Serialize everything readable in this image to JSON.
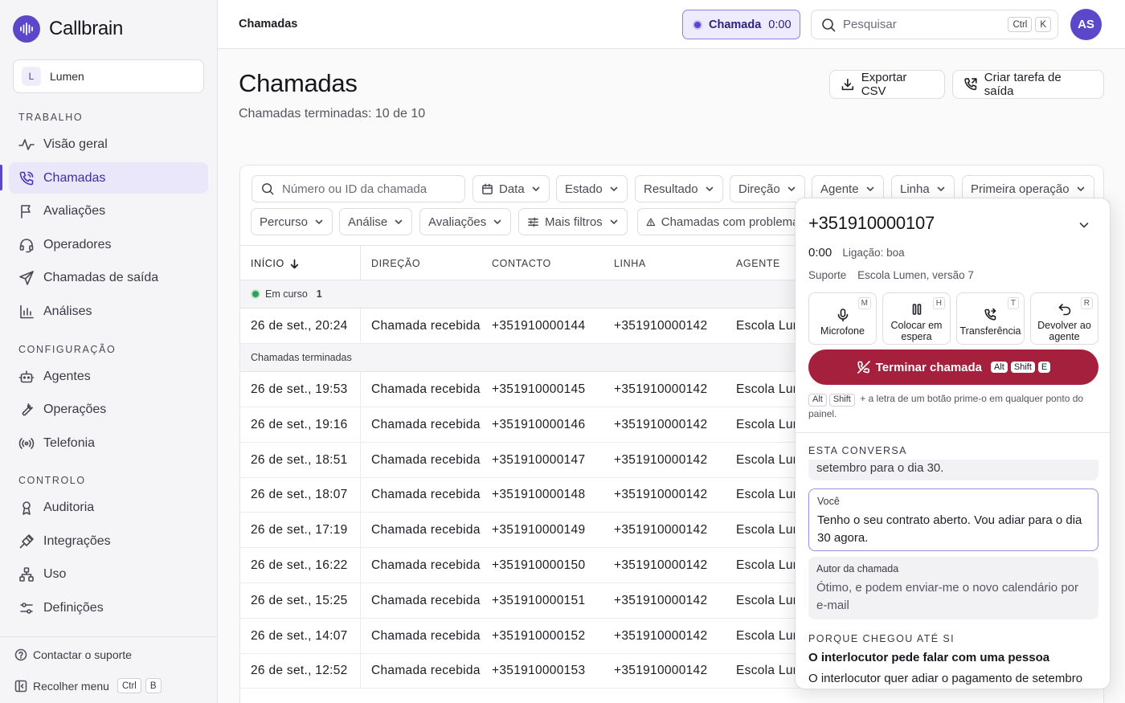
{
  "app": {
    "name": "Callbrain"
  },
  "workspace": {
    "initial": "L",
    "name": "Lumen"
  },
  "sidebar": {
    "sections": [
      {
        "label": "TRABALHO"
      },
      {
        "label": "CONFIGURAÇÃO"
      },
      {
        "label": "CONTROLO"
      }
    ],
    "items": [
      {
        "label": "Visão geral",
        "icon": "activity-icon"
      },
      {
        "label": "Chamadas",
        "icon": "phone-call-icon",
        "active": true
      },
      {
        "label": "Avaliações",
        "icon": "flag-icon"
      },
      {
        "label": "Operadores",
        "icon": "headset-icon"
      },
      {
        "label": "Chamadas de saída",
        "icon": "send-icon"
      },
      {
        "label": "Análises",
        "icon": "bar-chart-icon"
      },
      {
        "label": "Agentes",
        "icon": "bot-icon"
      },
      {
        "label": "Operações",
        "icon": "wrench-icon"
      },
      {
        "label": "Telefonia",
        "icon": "radio-icon"
      },
      {
        "label": "Auditoria",
        "icon": "audit-icon"
      },
      {
        "label": "Integrações",
        "icon": "plug-icon"
      },
      {
        "label": "Uso",
        "icon": "network-icon"
      },
      {
        "label": "Definições",
        "icon": "sliders-icon"
      }
    ],
    "support": "Contactar o suporte",
    "collapse": {
      "label": "Recolher menu",
      "keys": [
        "Ctrl",
        "B"
      ]
    }
  },
  "topbar": {
    "breadcrumb": "Chamadas",
    "call": {
      "label": "Chamada",
      "time": "0:00"
    },
    "search": {
      "placeholder": "Pesquisar",
      "keys": [
        "Ctrl",
        "K"
      ]
    },
    "avatar": "AS"
  },
  "page": {
    "title": "Chamadas",
    "subtitle": "Chamadas terminadas: 10 de 10",
    "export_label": "Exportar CSV",
    "outbound_label": "Criar tarefa de saída"
  },
  "filters": {
    "search_placeholder": "Número ou ID da chamada",
    "row1": [
      "Data",
      "Estado",
      "Resultado",
      "Direção",
      "Agente",
      "Linha",
      "Primeira operação"
    ],
    "row2": [
      "Percurso",
      "Análise",
      "Avaliações",
      "Mais filtros"
    ],
    "problems": "Chamadas com problemas"
  },
  "table": {
    "columns": [
      "INÍCIO",
      "DIREÇÃO",
      "CONTACTO",
      "LINHA",
      "AGENTE"
    ],
    "live_group": {
      "label": "Em curso",
      "count": "1"
    },
    "live_rows": [
      {
        "start": "26 de set., 20:24",
        "direction": "Chamada recebida",
        "contact": "+351910000144",
        "line": "+351910000142",
        "agent": "Escola Lumen"
      }
    ],
    "ended_group": {
      "label": "Chamadas terminadas"
    },
    "ended_rows": [
      {
        "start": "26 de set., 19:53",
        "direction": "Chamada recebida",
        "contact": "+351910000145",
        "line": "+351910000142",
        "agent": "Escola Lumen"
      },
      {
        "start": "26 de set., 19:16",
        "direction": "Chamada recebida",
        "contact": "+351910000146",
        "line": "+351910000142",
        "agent": "Escola Lumen"
      },
      {
        "start": "26 de set., 18:51",
        "direction": "Chamada recebida",
        "contact": "+351910000147",
        "line": "+351910000142",
        "agent": "Escola Lumen"
      },
      {
        "start": "26 de set., 18:07",
        "direction": "Chamada recebida",
        "contact": "+351910000148",
        "line": "+351910000142",
        "agent": "Escola Lumen"
      },
      {
        "start": "26 de set., 17:19",
        "direction": "Chamada recebida",
        "contact": "+351910000149",
        "line": "+351910000142",
        "agent": "Escola Lumen"
      },
      {
        "start": "26 de set., 16:22",
        "direction": "Chamada recebida",
        "contact": "+351910000150",
        "line": "+351910000142",
        "agent": "Escola Lumen"
      },
      {
        "start": "26 de set., 15:25",
        "direction": "Chamada recebida",
        "contact": "+351910000151",
        "line": "+351910000142",
        "agent": "Escola Lumen"
      },
      {
        "start": "26 de set., 14:07",
        "direction": "Chamada recebida",
        "contact": "+351910000152",
        "line": "+351910000142",
        "agent": "Escola Lumen"
      },
      {
        "start": "26 de set., 12:52",
        "direction": "Chamada recebida",
        "contact": "+351910000153",
        "line": "+351910000142",
        "agent": "Escola Lumen"
      }
    ]
  },
  "call_panel": {
    "phone": "+351910000107",
    "time": "0:00",
    "quality": "Ligação: boa",
    "operation": "Suporte",
    "line": "Escola Lumen, versão 7",
    "actions": [
      {
        "label": "Microfone",
        "key": "M",
        "icon": "mic-icon"
      },
      {
        "label": "Colocar em espera",
        "key": "H",
        "icon": "pause-icon"
      },
      {
        "label": "Transferência",
        "key": "T",
        "icon": "transfer-icon"
      },
      {
        "label": "Devolver ao agente",
        "key": "R",
        "icon": "return-icon"
      }
    ],
    "end_label": "Terminar chamada",
    "end_keys": [
      "Alt",
      "Shift",
      "E"
    ],
    "hint_keys": [
      "Alt",
      "Shift"
    ],
    "hint_text": "+ a letra de um botão prime-o em qualquer ponto do painel.",
    "conversation_title": "ESTA CONVERSA",
    "prev_message": "setembro para o dia 30.",
    "messages": [
      {
        "who": "Você",
        "text": "Tenho o seu contrato aberto. Vou adiar para o dia 30 agora."
      },
      {
        "who": "Autor da chamada",
        "text": "Ótimo, e podem enviar-me o novo calendário por e-mail"
      }
    ],
    "reason_title": "PORQUE CHEGOU ATÉ SI",
    "reason_heading": "O interlocutor pede falar com uma pessoa",
    "reason_text": "O interlocutor quer adiar o pagamento de setembro"
  }
}
